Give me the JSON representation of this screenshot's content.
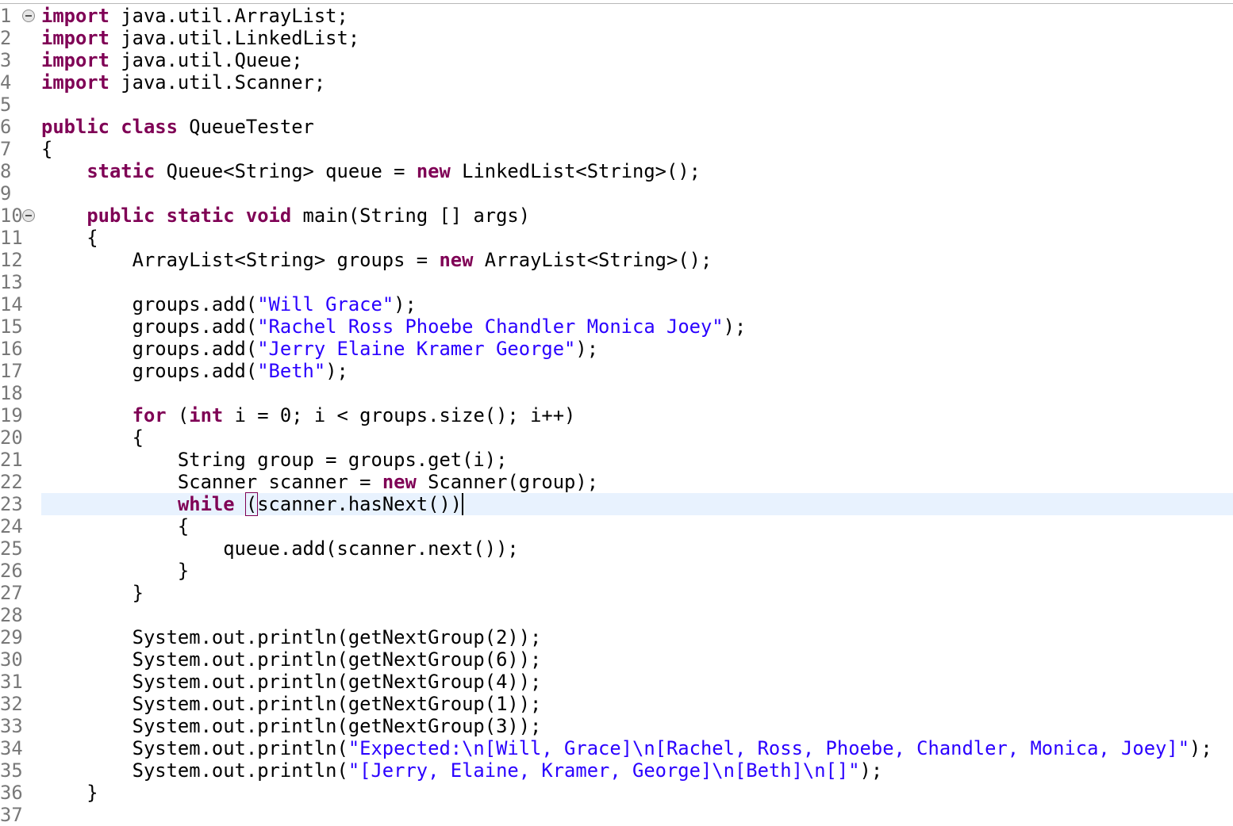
{
  "editor": {
    "language": "java",
    "current_line": 23,
    "colors": {
      "keyword": "#7f0055",
      "string": "#2a00ff",
      "text": "#000000",
      "line_number": "#787878",
      "current_line_bg": "#e8f2fe"
    },
    "lines": [
      {
        "n": "1",
        "fold": true,
        "tokens": [
          {
            "t": "import",
            "k": "kw"
          },
          {
            "t": " java.util.ArrayList;"
          }
        ]
      },
      {
        "n": "2",
        "tokens": [
          {
            "t": "import",
            "k": "kw"
          },
          {
            "t": " java.util.LinkedList;"
          }
        ]
      },
      {
        "n": "3",
        "tokens": [
          {
            "t": "import",
            "k": "kw"
          },
          {
            "t": " java.util.Queue;"
          }
        ]
      },
      {
        "n": "4",
        "tokens": [
          {
            "t": "import",
            "k": "kw"
          },
          {
            "t": " java.util.Scanner;"
          }
        ]
      },
      {
        "n": "5",
        "tokens": []
      },
      {
        "n": "6",
        "tokens": [
          {
            "t": "public",
            "k": "kw"
          },
          {
            "t": " "
          },
          {
            "t": "class",
            "k": "kw"
          },
          {
            "t": " QueueTester"
          }
        ]
      },
      {
        "n": "7",
        "tokens": [
          {
            "t": "{"
          }
        ]
      },
      {
        "n": "8",
        "tokens": [
          {
            "t": "    "
          },
          {
            "t": "static",
            "k": "kw"
          },
          {
            "t": " Queue<String> queue = "
          },
          {
            "t": "new",
            "k": "kw"
          },
          {
            "t": " LinkedList<String>();"
          }
        ]
      },
      {
        "n": "9",
        "tokens": []
      },
      {
        "n": "10",
        "fold": true,
        "tokens": [
          {
            "t": "    "
          },
          {
            "t": "public",
            "k": "kw"
          },
          {
            "t": " "
          },
          {
            "t": "static",
            "k": "kw"
          },
          {
            "t": " "
          },
          {
            "t": "void",
            "k": "kw"
          },
          {
            "t": " main(String [] args)"
          }
        ]
      },
      {
        "n": "11",
        "tokens": [
          {
            "t": "    {"
          }
        ]
      },
      {
        "n": "12",
        "tokens": [
          {
            "t": "        ArrayList<String> groups = "
          },
          {
            "t": "new",
            "k": "kw"
          },
          {
            "t": " ArrayList<String>();"
          }
        ]
      },
      {
        "n": "13",
        "tokens": []
      },
      {
        "n": "14",
        "tokens": [
          {
            "t": "        groups.add("
          },
          {
            "t": "\"Will Grace\"",
            "k": "str"
          },
          {
            "t": ");"
          }
        ]
      },
      {
        "n": "15",
        "tokens": [
          {
            "t": "        groups.add("
          },
          {
            "t": "\"Rachel Ross Phoebe Chandler Monica Joey\"",
            "k": "str"
          },
          {
            "t": ");"
          }
        ]
      },
      {
        "n": "16",
        "tokens": [
          {
            "t": "        groups.add("
          },
          {
            "t": "\"Jerry Elaine Kramer George\"",
            "k": "str"
          },
          {
            "t": ");"
          }
        ]
      },
      {
        "n": "17",
        "tokens": [
          {
            "t": "        groups.add("
          },
          {
            "t": "\"Beth\"",
            "k": "str"
          },
          {
            "t": ");"
          }
        ]
      },
      {
        "n": "18",
        "tokens": []
      },
      {
        "n": "19",
        "tokens": [
          {
            "t": "        "
          },
          {
            "t": "for",
            "k": "kw"
          },
          {
            "t": " ("
          },
          {
            "t": "int",
            "k": "kw"
          },
          {
            "t": " i = 0; i < groups.size(); i++)"
          }
        ]
      },
      {
        "n": "20",
        "tokens": [
          {
            "t": "        {"
          }
        ]
      },
      {
        "n": "21",
        "tokens": [
          {
            "t": "            String group = groups.get(i);"
          }
        ]
      },
      {
        "n": "22",
        "tokens": [
          {
            "t": "            Scanner scanner = "
          },
          {
            "t": "new",
            "k": "kw"
          },
          {
            "t": " Scanner(group);"
          }
        ]
      },
      {
        "n": "23",
        "current": true,
        "tokens": [
          {
            "t": "            "
          },
          {
            "t": "while",
            "k": "kw"
          },
          {
            "t": " "
          },
          {
            "t": "(",
            "k": "bracket"
          },
          {
            "t": "scanner.hasNext())"
          },
          {
            "t": "",
            "k": "caret"
          }
        ]
      },
      {
        "n": "24",
        "tokens": [
          {
            "t": "            {"
          }
        ]
      },
      {
        "n": "25",
        "tokens": [
          {
            "t": "                queue.add(scanner.next());"
          }
        ]
      },
      {
        "n": "26",
        "tokens": [
          {
            "t": "            }"
          }
        ]
      },
      {
        "n": "27",
        "tokens": [
          {
            "t": "        }"
          }
        ]
      },
      {
        "n": "28",
        "tokens": []
      },
      {
        "n": "29",
        "tokens": [
          {
            "t": "        System.out.println(getNextGroup(2));"
          }
        ]
      },
      {
        "n": "30",
        "tokens": [
          {
            "t": "        System.out.println(getNextGroup(6));"
          }
        ]
      },
      {
        "n": "31",
        "tokens": [
          {
            "t": "        System.out.println(getNextGroup(4));"
          }
        ]
      },
      {
        "n": "32",
        "tokens": [
          {
            "t": "        System.out.println(getNextGroup(1));"
          }
        ]
      },
      {
        "n": "33",
        "tokens": [
          {
            "t": "        System.out.println(getNextGroup(3));"
          }
        ]
      },
      {
        "n": "34",
        "tokens": [
          {
            "t": "        System.out.println("
          },
          {
            "t": "\"Expected:\\n[Will, Grace]\\n[Rachel, Ross, Phoebe, Chandler, Monica, Joey]\"",
            "k": "str"
          },
          {
            "t": ");"
          }
        ]
      },
      {
        "n": "35",
        "tokens": [
          {
            "t": "        System.out.println("
          },
          {
            "t": "\"[Jerry, Elaine, Kramer, George]\\n[Beth]\\n[]\"",
            "k": "str"
          },
          {
            "t": ");"
          }
        ]
      },
      {
        "n": "36",
        "tokens": [
          {
            "t": "    }"
          }
        ]
      },
      {
        "n": "37",
        "tokens": []
      }
    ]
  }
}
